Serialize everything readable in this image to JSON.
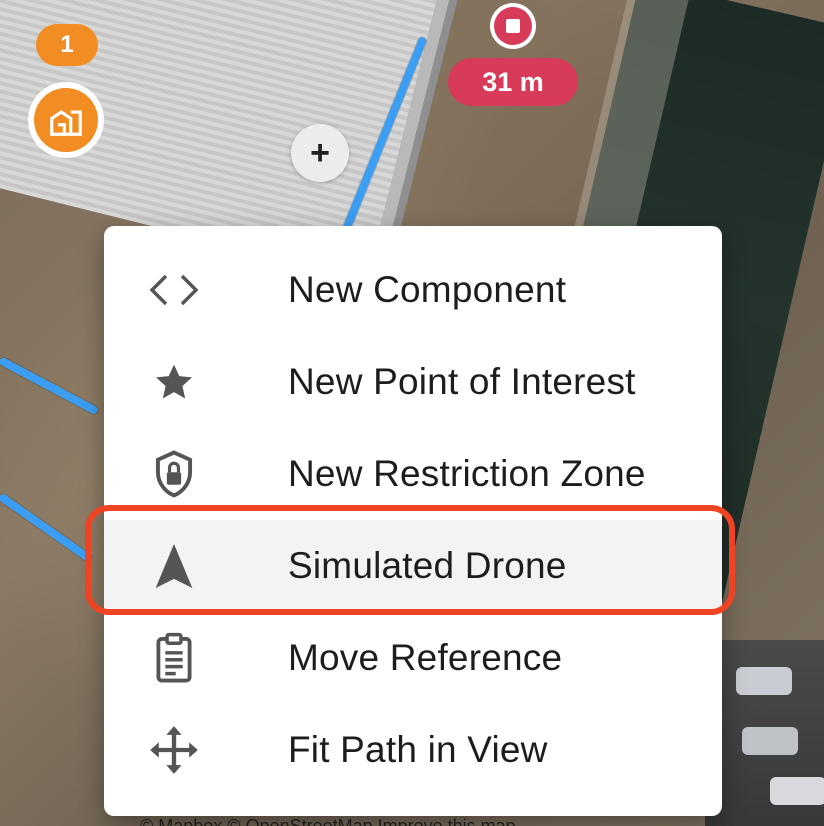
{
  "map": {
    "poi_count": "1",
    "distance_badge": "31 m",
    "add_waypoint_symbol": "+",
    "attribution": "© Mapbox © OpenStreetMap Improve this map"
  },
  "colors": {
    "path": "#3b9ef3",
    "poi": "#f28d23",
    "endpoint": "#d83a5a",
    "highlight": "#ef4323"
  },
  "context_menu": {
    "items": [
      {
        "label": "New Component",
        "icon": "code-brackets-icon"
      },
      {
        "label": "New Point of Interest",
        "icon": "star-icon"
      },
      {
        "label": "New Restriction Zone",
        "icon": "lock-shield-icon"
      },
      {
        "label": "Simulated Drone",
        "icon": "navigation-arrow-icon"
      },
      {
        "label": "Move Reference",
        "icon": "clipboard-icon"
      },
      {
        "label": "Fit Path in View",
        "icon": "move-arrows-icon"
      }
    ],
    "highlighted_item": "Simulated Drone"
  }
}
